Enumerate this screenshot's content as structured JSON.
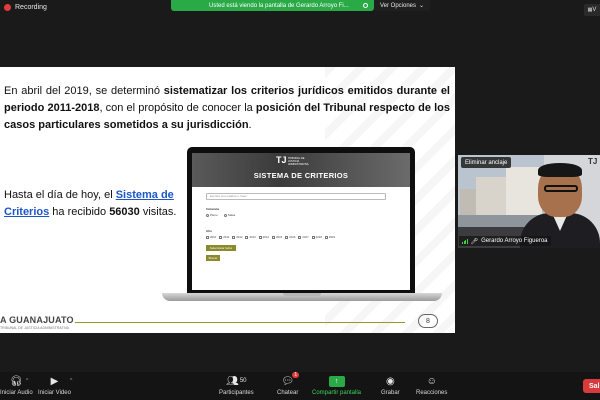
{
  "recording": {
    "label": "Recording"
  },
  "share_banner": {
    "text": "Usted está viendo la pantalla de Gerardo Arroyo Fi..."
  },
  "view_options": {
    "label": "Ver Opciones",
    "view_button": "V"
  },
  "slide": {
    "para1": {
      "t1": "En abril del 2019, se determinó ",
      "b1": "sistematizar los criterios jurídicos emitidos durante el periodo 2011-2018",
      "t2": ", con el propósito de conocer la ",
      "b2": "posición del Tribunal respecto de los casos particulares sometidos a su jurisdicción",
      "t3": "."
    },
    "para2": {
      "t1": "Hasta el día de hoy, el ",
      "link": "Sistema de Criterios",
      "t2": " ha recibido ",
      "b1": "56030",
      "t3": " visitas."
    },
    "laptop": {
      "logo": "TJ",
      "logo_text": "TRIBUNAL DE JUSTICIA ADMINISTRATIVA",
      "title": "SISTEMA DE CRITERIOS",
      "search_placeholder": "Escriba una palabra o frase",
      "instancia_label": "Instancia",
      "radios": [
        "Pleno",
        "Salas"
      ],
      "year_label": "Año",
      "years": [
        "2010",
        "2011",
        "2012",
        "2013",
        "2014",
        "2015",
        "2016",
        "2017",
        "2018",
        "2019"
      ],
      "btn1": "Seleccionar todos",
      "btn2": "Buscar"
    },
    "footer_org": "A GUANAJUATO",
    "footer_sub": "TRIBUNAL DE JUSTICIA ADMINISTRATIVA",
    "page_number": "8"
  },
  "video": {
    "unpin_label": "Eliminar anclaje",
    "participant_name": "Gerardo Arroyo Figueroa",
    "logo": "TJ"
  },
  "toolbar": {
    "audio": "Iniciar Audio",
    "video": "Iniciar Video",
    "participants": "Participantes",
    "participants_count": "50",
    "chat": "Chatear",
    "chat_badge": "1",
    "share": "Compartir pantalla",
    "record": "Grabar",
    "reactions": "Reacciones",
    "end": "Sali"
  }
}
